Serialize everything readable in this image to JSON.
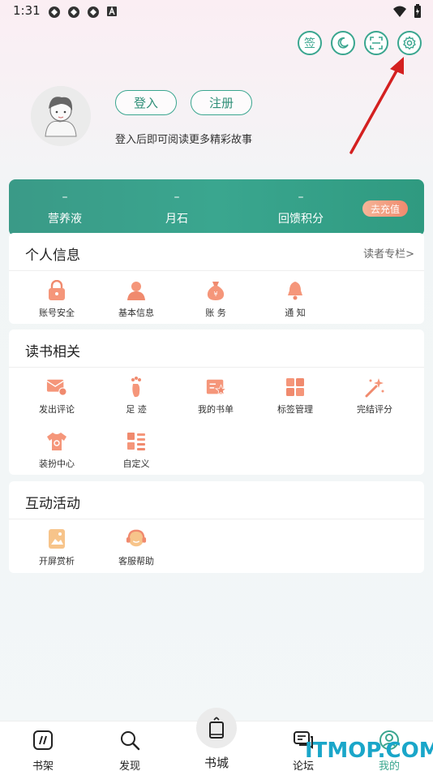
{
  "status_bar": {
    "time": "1:31"
  },
  "top_actions": {
    "checkin_label": "签"
  },
  "profile": {
    "login_label": "登入",
    "register_label": "注册",
    "hint": "登入后即可阅读更多精彩故事"
  },
  "stats": {
    "items": [
      {
        "value": "–",
        "label": "营养液"
      },
      {
        "value": "–",
        "label": "月石"
      },
      {
        "value": "–",
        "label": "回馈积分"
      }
    ],
    "recharge_label": "去充值"
  },
  "personal": {
    "title": "个人信息",
    "link": "读者专栏>",
    "items": [
      {
        "label": "账号安全",
        "icon": "lock-icon"
      },
      {
        "label": "基本信息",
        "icon": "person-icon"
      },
      {
        "label": "账 务",
        "icon": "money-bag-icon"
      },
      {
        "label": "通 知",
        "icon": "bell-icon"
      }
    ]
  },
  "reading": {
    "title": "读书相关",
    "items": [
      {
        "label": "发出评论",
        "icon": "comment-icon"
      },
      {
        "label": "足 迹",
        "icon": "footprint-icon"
      },
      {
        "label": "我的书单",
        "icon": "booklist-icon"
      },
      {
        "label": "标签管理",
        "icon": "tag-grid-icon"
      },
      {
        "label": "完结评分",
        "icon": "magic-wand-icon"
      },
      {
        "label": "装扮中心",
        "icon": "shirt-icon"
      },
      {
        "label": "自定义",
        "icon": "custom-list-icon"
      }
    ]
  },
  "activities": {
    "title": "互动活动",
    "items": [
      {
        "label": "开屏赏析",
        "icon": "splash-image-icon"
      },
      {
        "label": "客服帮助",
        "icon": "service-icon"
      }
    ]
  },
  "bottom_nav": {
    "items": [
      {
        "label": "书架"
      },
      {
        "label": "发现"
      },
      {
        "label": "书城"
      },
      {
        "label": "论坛"
      },
      {
        "label": "我的"
      }
    ]
  },
  "watermark": "ITMOP.COM",
  "colors": {
    "accent": "#3aa68f",
    "coral": "#f08a6e",
    "arrow": "#d42020"
  }
}
